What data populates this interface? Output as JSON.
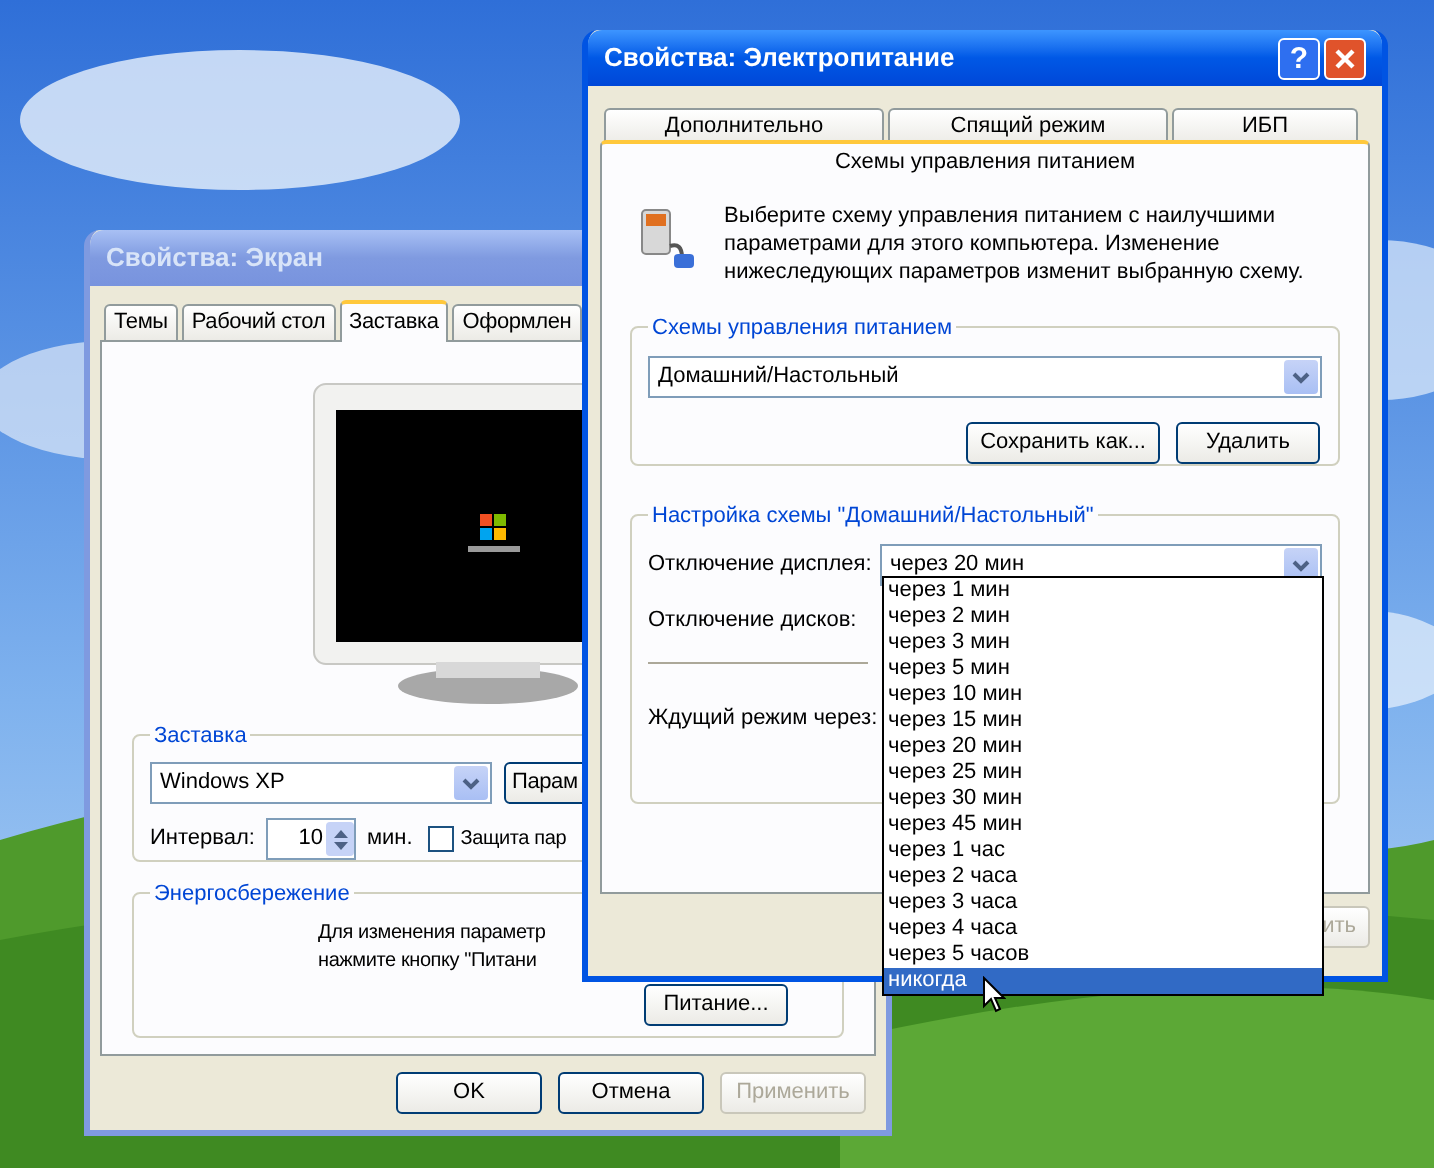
{
  "display_window": {
    "title": "Свойства: Экран",
    "active": false,
    "tabs": [
      {
        "label": "Темы",
        "selected": false
      },
      {
        "label": "Рабочий стол",
        "selected": false
      },
      {
        "label": "Заставка",
        "selected": true
      },
      {
        "label": "Оформлен",
        "selected": false
      }
    ],
    "screensaver_group": {
      "title": "Заставка",
      "value": "Windows XP",
      "settings_button": "Парам",
      "interval_label": "Интервал:",
      "interval_value": "10",
      "interval_unit": "мин.",
      "password_label": "Защита пар",
      "password_checked": false
    },
    "energy_group": {
      "title": "Энергосбережение",
      "text_lines": [
        "Для изменения параметр",
        "нажмите кнопку \"Питани"
      ],
      "button": "Питание..."
    },
    "buttons": [
      {
        "label": "OK",
        "disabled": false
      },
      {
        "label": "Отмена",
        "disabled": false
      },
      {
        "label": "Применить",
        "disabled": true
      }
    ]
  },
  "power_window": {
    "title": "Свойства: Электропитание",
    "active": true,
    "help_button": "?",
    "tabs": [
      {
        "label": "Дополнительно",
        "selected": false
      },
      {
        "label": "Спящий режим",
        "selected": false
      },
      {
        "label": "ИБП",
        "selected": false
      },
      {
        "label": "Схемы управления питанием",
        "selected": true
      }
    ],
    "intro": "Выберите схему управления питанием с наилучшими параметрами для этого компьютера. Изменение нижеследующих параметров изменит выбранную схему.",
    "schemes_group": {
      "title": "Схемы управления питанием",
      "value": "Домашний/Настольный",
      "buttons": [
        "Сохранить как...",
        "Удалить"
      ]
    },
    "settings_group": {
      "title": "Настройка схемы \"Домашний/Настольный\"",
      "display_label": "Отключение дисплея:",
      "display_value": "через 20 мин",
      "disks_label": "Отключение дисков:",
      "standby_label": "Ждущий режим через:"
    },
    "buttons": [
      {
        "label": "ить",
        "disabled": true
      }
    ],
    "dropdown": {
      "items": [
        {
          "label": "через 1 мин",
          "selected": false
        },
        {
          "label": "через 2 мин",
          "selected": false
        },
        {
          "label": "через 3 мин",
          "selected": false
        },
        {
          "label": "через 5 мин",
          "selected": false
        },
        {
          "label": "через 10 мин",
          "selected": false
        },
        {
          "label": "через 15 мин",
          "selected": false
        },
        {
          "label": "через 20 мин",
          "selected": false
        },
        {
          "label": "через 25 мин",
          "selected": false
        },
        {
          "label": "через 30 мин",
          "selected": false
        },
        {
          "label": "через 45 мин",
          "selected": false
        },
        {
          "label": "через 1 час",
          "selected": false
        },
        {
          "label": "через 2 часа",
          "selected": false
        },
        {
          "label": "через 3 часа",
          "selected": false
        },
        {
          "label": "через 4 часа",
          "selected": false
        },
        {
          "label": "через 5 часов",
          "selected": false
        },
        {
          "label": "никогда",
          "selected": true
        }
      ]
    }
  }
}
